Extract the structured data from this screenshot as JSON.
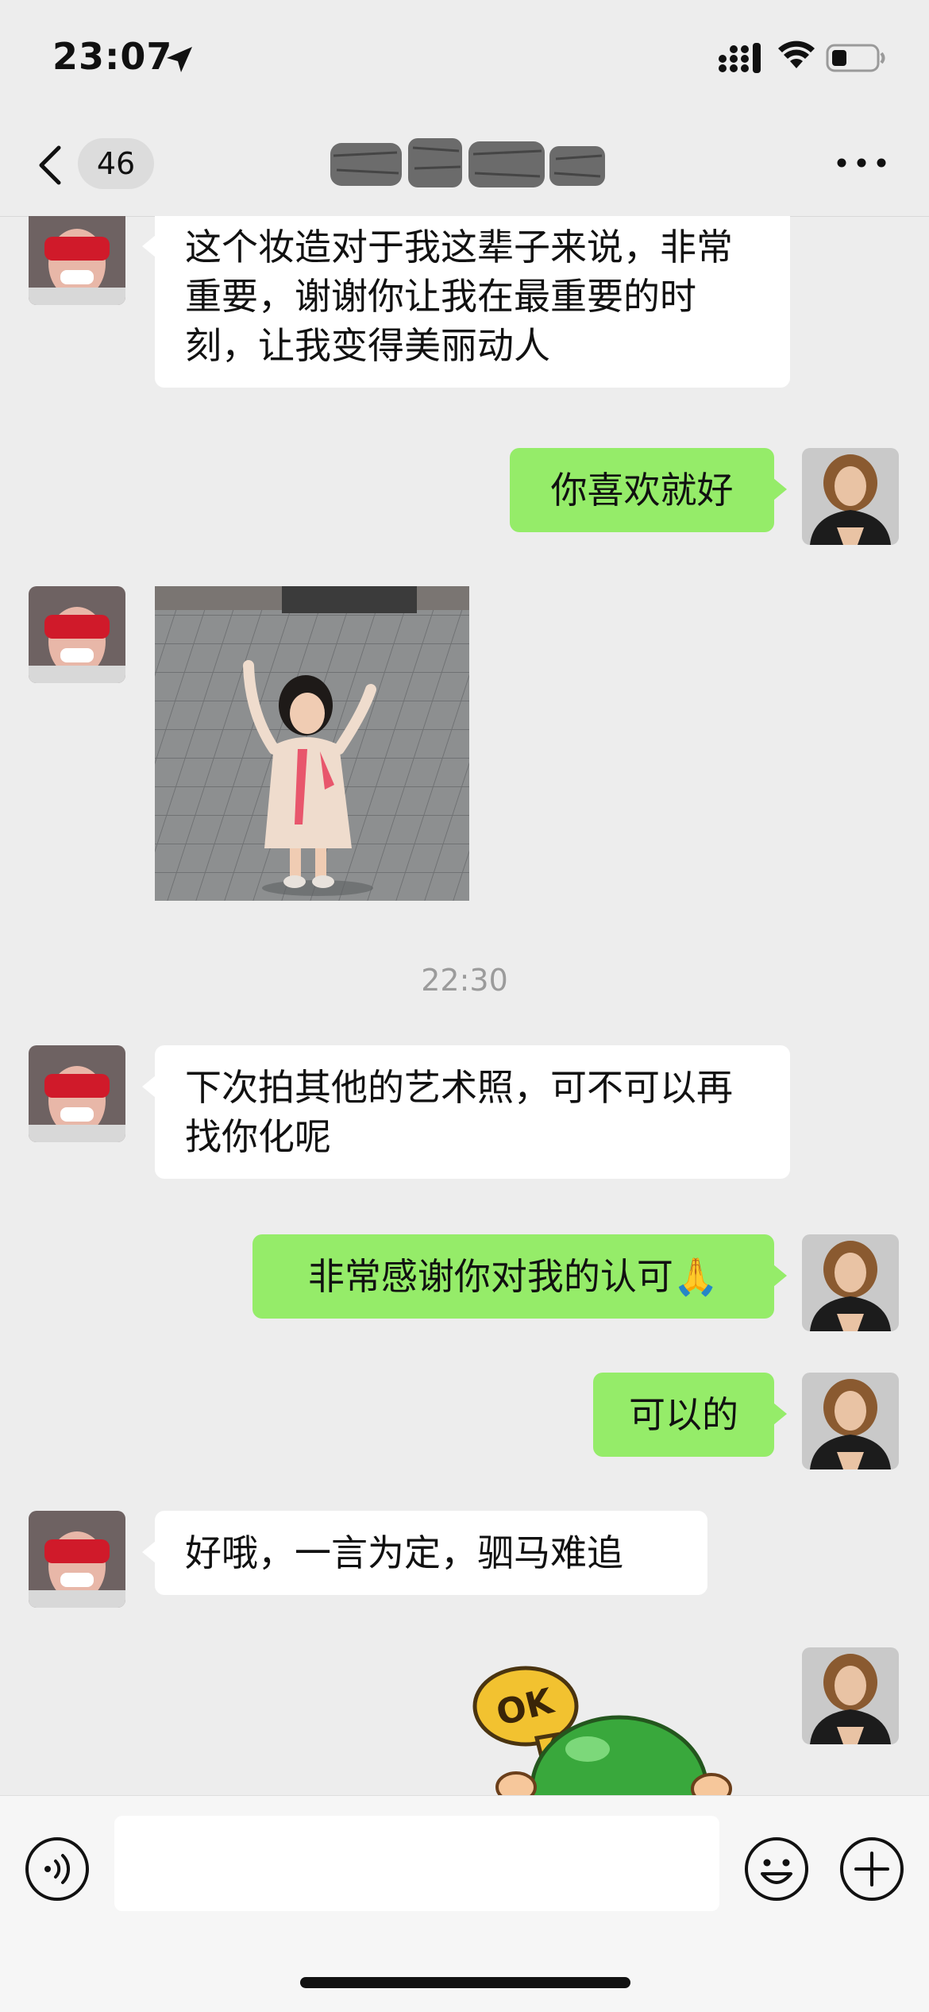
{
  "status_bar": {
    "time": "23:07"
  },
  "nav": {
    "unread_count": "46"
  },
  "messages": [
    {
      "side": "in",
      "text": "这个妆造对于我这辈子来说，非常重要，谢谢你让我在最重要的时刻，让我变得美丽动人"
    },
    {
      "side": "out",
      "text": "你喜欢就好"
    },
    {
      "side": "in",
      "type": "image"
    },
    {
      "type": "time",
      "text": "22:30"
    },
    {
      "side": "in",
      "text": "下次拍其他的艺术照，可不可以再找你化呢"
    },
    {
      "side": "out",
      "text": "非常感谢你对我的认可🙏"
    },
    {
      "side": "out",
      "text": "可以的"
    },
    {
      "side": "in",
      "text": "好哦，一言为定，驷马难追"
    },
    {
      "side": "out",
      "type": "sticker",
      "sticker_text": "OK"
    }
  ],
  "input": {
    "placeholder": ""
  },
  "colors": {
    "outgoing_bubble": "#95ec69",
    "incoming_bubble": "#ffffff",
    "background": "#ededed"
  },
  "icons": [
    "location-arrow-icon",
    "signal-icon",
    "wifi-icon",
    "battery-icon",
    "chevron-left-icon",
    "more-icon",
    "voice-icon",
    "emoji-icon",
    "plus-icon"
  ]
}
